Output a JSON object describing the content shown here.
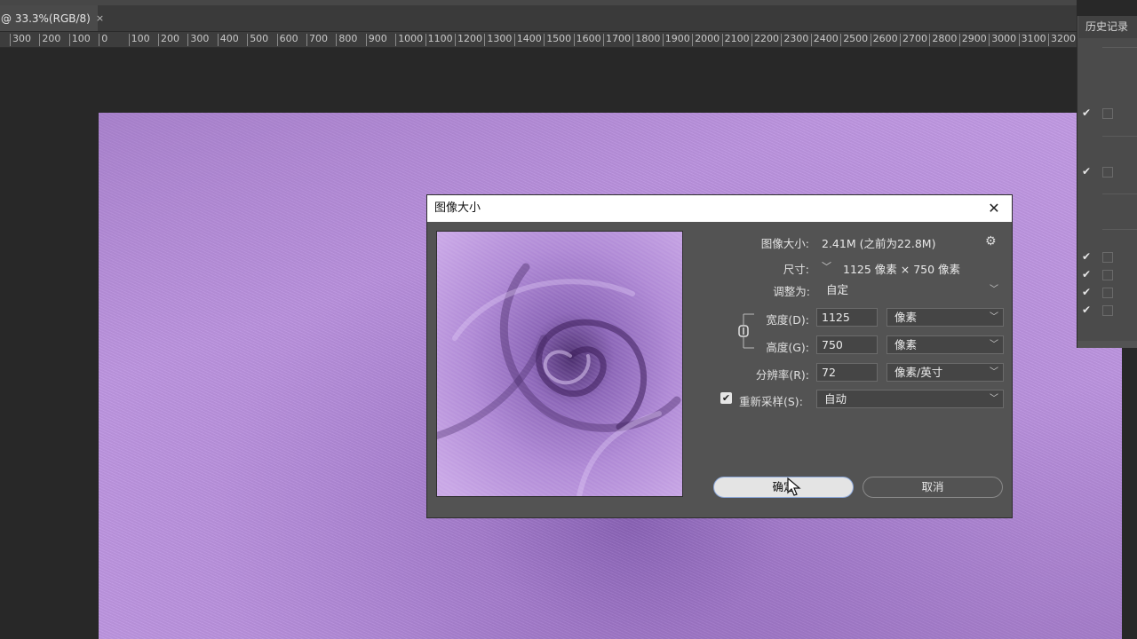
{
  "doc_tab": {
    "title": "@ 33.3%(RGB/8)",
    "close": "×"
  },
  "ruler": {
    "labels": [
      "300",
      "200",
      "100",
      "0",
      "100",
      "200",
      "300",
      "400",
      "500",
      "600",
      "700",
      "800",
      "900",
      "1000",
      "1100",
      "1200",
      "1300",
      "1400",
      "1500",
      "1600",
      "1700",
      "1800",
      "1900",
      "2000",
      "2100",
      "2200",
      "2300",
      "2400",
      "2500",
      "2600",
      "2700",
      "2800",
      "2900",
      "3000",
      "3100",
      "3200"
    ]
  },
  "history": {
    "tab_label": "历史记录",
    "check": "✔"
  },
  "dialog": {
    "title": "图像大小",
    "close": "✕",
    "image_size_label": "图像大小:",
    "image_size_value": "2.41M (之前为22.8M)",
    "dimensions_label": "尺寸:",
    "dimensions_value": "1125 像素 × 750 像素",
    "fit_to_label": "调整为:",
    "fit_to_value": "自定",
    "width_label": "宽度(D):",
    "width_value": "1125",
    "width_unit": "像素",
    "height_label": "高度(G):",
    "height_value": "750",
    "height_unit": "像素",
    "resolution_label": "分辨率(R):",
    "resolution_value": "72",
    "resolution_unit": "像素/英寸",
    "resample_label": "重新采样(S):",
    "resample_value": "自动",
    "resample_checked": "✔",
    "ok_label": "确定",
    "cancel_label": "取消"
  },
  "colors": {
    "accent": "#8aa6d8",
    "fabric": "#b991dd",
    "panel": "#535353"
  }
}
